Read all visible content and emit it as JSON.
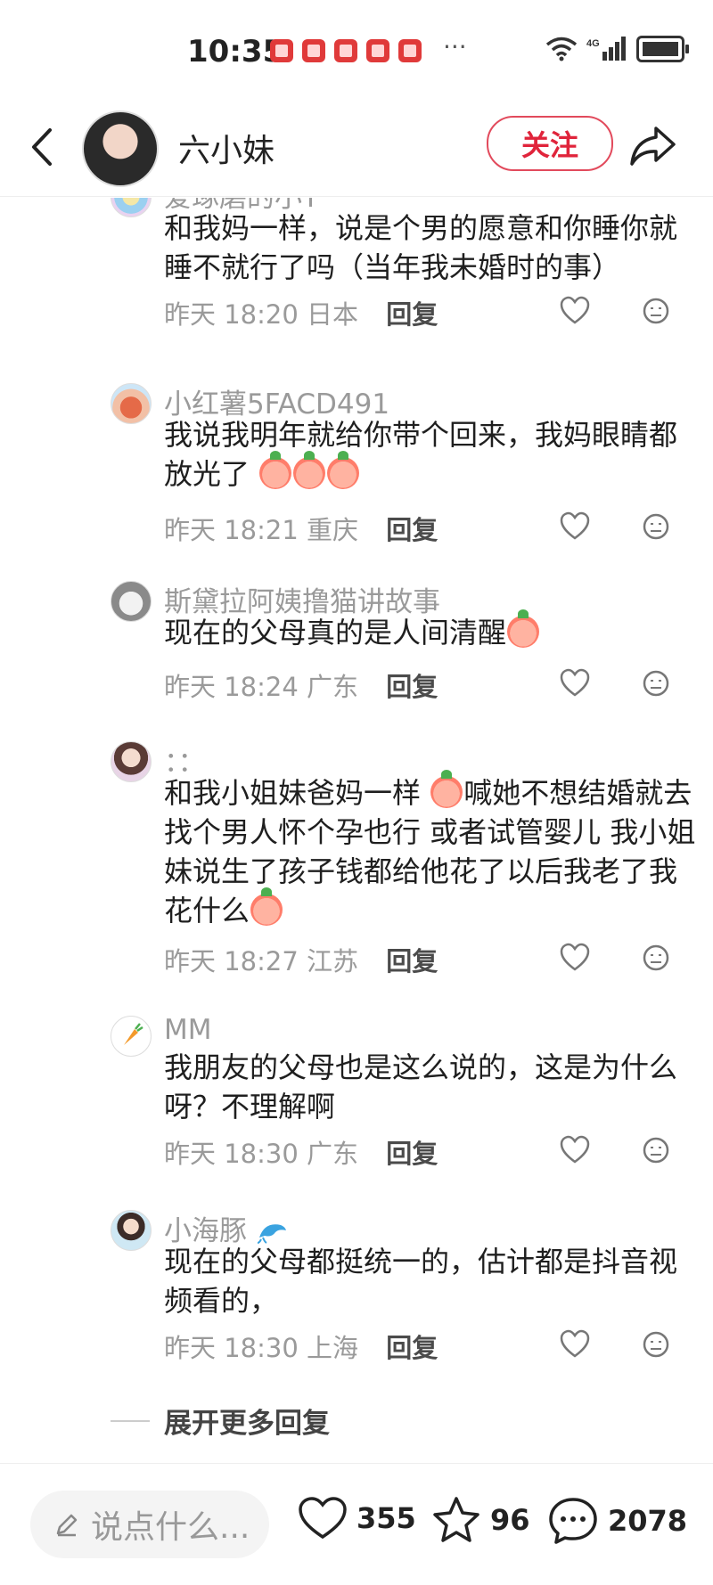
{
  "status_bar": {
    "time": "10:35",
    "more": "···",
    "network": "4G"
  },
  "header": {
    "username": "六小妹",
    "follow_label": "关注"
  },
  "comments": [
    {
      "name": "爱琢磨的小Y",
      "text": "和我妈一样，说是个男的愿意和你睡你就睡不就行了吗（当年我未婚时的事）",
      "time": "昨天 18:20",
      "location": "日本",
      "reply": "回复"
    },
    {
      "name": "小红薯5FACD491",
      "text": "我说我明年就给你带个回来，我妈眼睛都放光了",
      "time": "昨天 18:21",
      "location": "重庆",
      "reply": "回复"
    },
    {
      "name": "斯黛拉阿姨撸猫讲故事",
      "text": "现在的父母真的是人间清醒",
      "time": "昨天 18:24",
      "location": "广东",
      "reply": "回复"
    },
    {
      "name": "：：",
      "text_a": "和我小姐妹爸妈一样",
      "text_b": "喊她不想结婚就去找个男人怀个孕也行 或者试管婴儿 我小姐妹说生了孩子钱都给他花了以后我老了我花什么",
      "time": "昨天 18:27",
      "location": "江苏",
      "reply": "回复"
    },
    {
      "name": "MM",
      "text": "我朋友的父母也是这么说的，这是为什么呀？不理解啊",
      "time": "昨天 18:30",
      "location": "广东",
      "reply": "回复"
    },
    {
      "name": "小海豚",
      "text": "现在的父母都挺统一的，估计都是抖音视频看的，",
      "time": "昨天 18:30",
      "location": "上海",
      "reply": "回复"
    }
  ],
  "more_replies": "展开更多回复",
  "bottom_bar": {
    "input_placeholder": "说点什么...",
    "likes": "355",
    "stars": "96",
    "comments": "2078"
  },
  "colors": {
    "accent": "#e0243b",
    "meta_gray": "#9a9a9a"
  }
}
